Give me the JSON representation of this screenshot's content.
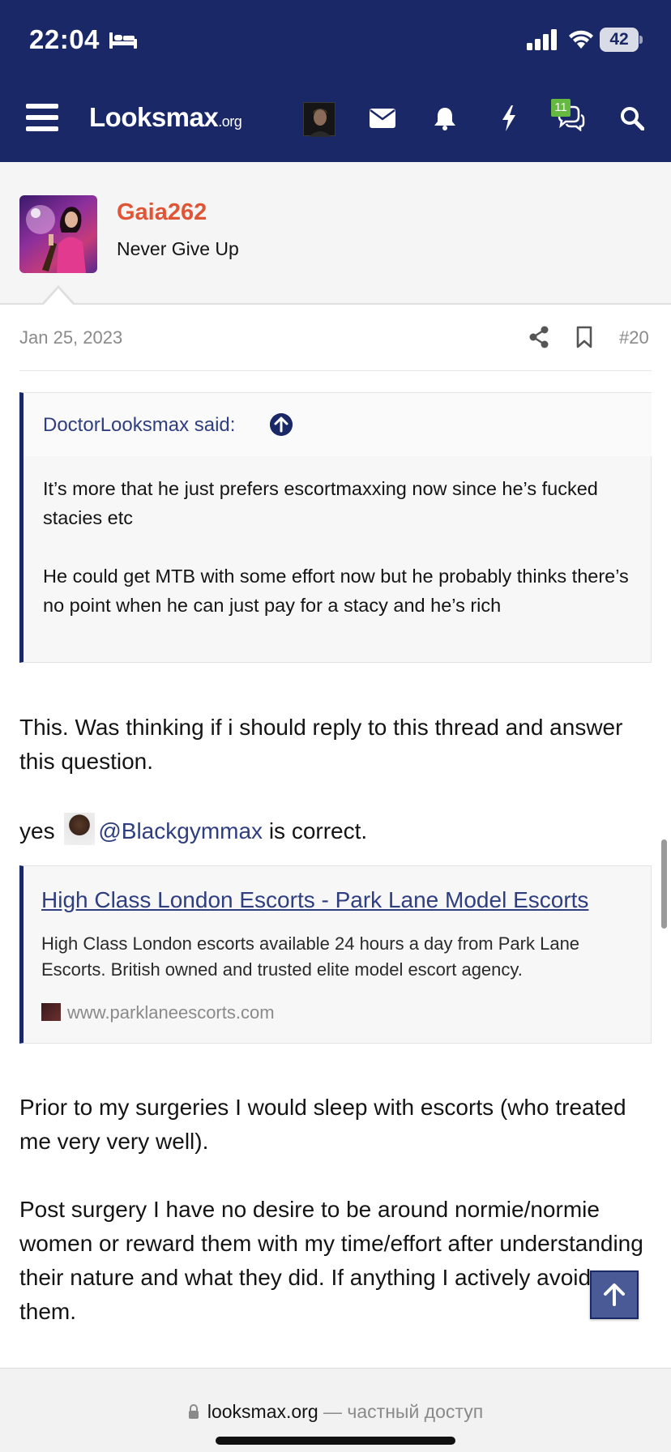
{
  "status_bar": {
    "time": "22:04",
    "battery": "42"
  },
  "navbar": {
    "logo_main": "Looksmax",
    "logo_suffix": ".org",
    "icons": [
      "menu-icon",
      "mail-icon",
      "bell-icon",
      "bolt-icon",
      "chat-icon",
      "search-icon"
    ],
    "chat_badge": "11"
  },
  "profile": {
    "name": "Gaia262",
    "user_title": "Never Give Up"
  },
  "post": {
    "date": "Jan 25, 2023",
    "number": "#20"
  },
  "quote": {
    "author": "DoctorLooksmax said:",
    "paragraphs": [
      "It’s more that he just prefers escortmaxxing now since he’s fucked stacies etc",
      "He could get MTB with some effort now but he probably thinks there’s no point when he can just pay for a stacy and he’s rich"
    ]
  },
  "body": {
    "p1": "This. Was thinking if i should reply to this thread and answer this question.",
    "p2_prefix": "yes",
    "p2_mention": "@Blackgymmax",
    "p2_suffix": "is correct.",
    "p3": "Prior to my surgeries I would sleep with escorts (who treated me very very well).",
    "p4": "Post surgery I have no desire to be around normie/normie women or reward them with my time/effort after understanding their nature and what they did. If anything I actively avoid them."
  },
  "link_preview": {
    "title": "High Class London Escorts - Park Lane Model Escorts",
    "description": "High Class London escorts available 24 hours a day from Park Lane Escorts. British owned and trusted elite model escort agency.",
    "site": "www.parklaneescorts.com"
  },
  "browser": {
    "domain": "looksmax.org",
    "suffix": " — частный доступ"
  },
  "colors": {
    "header": "#1a2867",
    "username": "#e05536",
    "link": "#2f3e7f",
    "badge": "#65b840"
  }
}
